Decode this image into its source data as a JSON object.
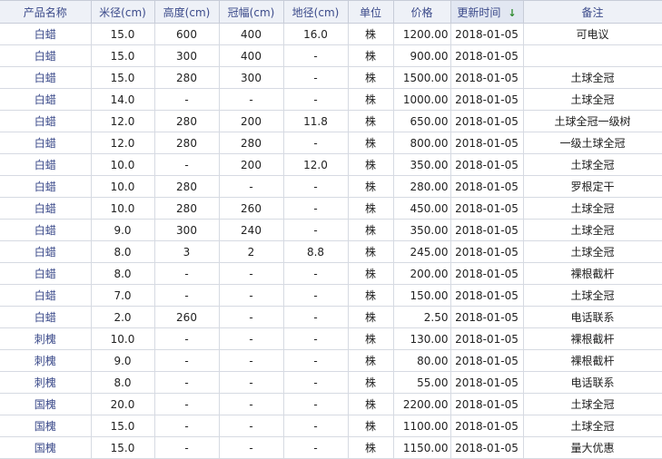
{
  "headers": {
    "name": "产品名称",
    "diameter": "米径(cm)",
    "height": "高度(cm)",
    "crown": "冠幅(cm)",
    "ground": "地径(cm)",
    "unit": "单位",
    "price": "价格",
    "updated": "更新时间",
    "note": "备注"
  },
  "sort_icon": "sort-down-arrow-icon",
  "sort_symbol": "↓",
  "rows": [
    {
      "name": "白蜡",
      "diameter": "15.0",
      "height": "600",
      "crown": "400",
      "ground": "16.0",
      "unit": "株",
      "price": "1200.00",
      "updated": "2018-01-05",
      "note": "可电议"
    },
    {
      "name": "白蜡",
      "diameter": "15.0",
      "height": "300",
      "crown": "400",
      "ground": "-",
      "unit": "株",
      "price": "900.00",
      "updated": "2018-01-05",
      "note": ""
    },
    {
      "name": "白蜡",
      "diameter": "15.0",
      "height": "280",
      "crown": "300",
      "ground": "-",
      "unit": "株",
      "price": "1500.00",
      "updated": "2018-01-05",
      "note": "土球全冠"
    },
    {
      "name": "白蜡",
      "diameter": "14.0",
      "height": "-",
      "crown": "-",
      "ground": "-",
      "unit": "株",
      "price": "1000.00",
      "updated": "2018-01-05",
      "note": "土球全冠"
    },
    {
      "name": "白蜡",
      "diameter": "12.0",
      "height": "280",
      "crown": "200",
      "ground": "11.8",
      "unit": "株",
      "price": "650.00",
      "updated": "2018-01-05",
      "note": "土球全冠一级树"
    },
    {
      "name": "白蜡",
      "diameter": "12.0",
      "height": "280",
      "crown": "280",
      "ground": "-",
      "unit": "株",
      "price": "800.00",
      "updated": "2018-01-05",
      "note": "一级土球全冠"
    },
    {
      "name": "白蜡",
      "diameter": "10.0",
      "height": "-",
      "crown": "200",
      "ground": "12.0",
      "unit": "株",
      "price": "350.00",
      "updated": "2018-01-05",
      "note": "土球全冠"
    },
    {
      "name": "白蜡",
      "diameter": "10.0",
      "height": "280",
      "crown": "-",
      "ground": "-",
      "unit": "株",
      "price": "280.00",
      "updated": "2018-01-05",
      "note": "罗根定干"
    },
    {
      "name": "白蜡",
      "diameter": "10.0",
      "height": "280",
      "crown": "260",
      "ground": "-",
      "unit": "株",
      "price": "450.00",
      "updated": "2018-01-05",
      "note": "土球全冠"
    },
    {
      "name": "白蜡",
      "diameter": "9.0",
      "height": "300",
      "crown": "240",
      "ground": "-",
      "unit": "株",
      "price": "350.00",
      "updated": "2018-01-05",
      "note": "土球全冠"
    },
    {
      "name": "白蜡",
      "diameter": "8.0",
      "height": "3",
      "crown": "2",
      "ground": "8.8",
      "unit": "株",
      "price": "245.00",
      "updated": "2018-01-05",
      "note": "土球全冠"
    },
    {
      "name": "白蜡",
      "diameter": "8.0",
      "height": "-",
      "crown": "-",
      "ground": "-",
      "unit": "株",
      "price": "200.00",
      "updated": "2018-01-05",
      "note": "裸根截杆"
    },
    {
      "name": "白蜡",
      "diameter": "7.0",
      "height": "-",
      "crown": "-",
      "ground": "-",
      "unit": "株",
      "price": "150.00",
      "updated": "2018-01-05",
      "note": "土球全冠"
    },
    {
      "name": "白蜡",
      "diameter": "2.0",
      "height": "260",
      "crown": "-",
      "ground": "-",
      "unit": "株",
      "price": "2.50",
      "updated": "2018-01-05",
      "note": "电话联系"
    },
    {
      "name": "刺槐",
      "diameter": "10.0",
      "height": "-",
      "crown": "-",
      "ground": "-",
      "unit": "株",
      "price": "130.00",
      "updated": "2018-01-05",
      "note": "裸根截杆"
    },
    {
      "name": "刺槐",
      "diameter": "9.0",
      "height": "-",
      "crown": "-",
      "ground": "-",
      "unit": "株",
      "price": "80.00",
      "updated": "2018-01-05",
      "note": "裸根截杆"
    },
    {
      "name": "刺槐",
      "diameter": "8.0",
      "height": "-",
      "crown": "-",
      "ground": "-",
      "unit": "株",
      "price": "55.00",
      "updated": "2018-01-05",
      "note": "电话联系"
    },
    {
      "name": "国槐",
      "diameter": "20.0",
      "height": "-",
      "crown": "-",
      "ground": "-",
      "unit": "株",
      "price": "2200.00",
      "updated": "2018-01-05",
      "note": "土球全冠"
    },
    {
      "name": "国槐",
      "diameter": "15.0",
      "height": "-",
      "crown": "-",
      "ground": "-",
      "unit": "株",
      "price": "1100.00",
      "updated": "2018-01-05",
      "note": "土球全冠"
    },
    {
      "name": "国槐",
      "diameter": "15.0",
      "height": "-",
      "crown": "-",
      "ground": "-",
      "unit": "株",
      "price": "1150.00",
      "updated": "2018-01-05",
      "note": "量大优惠"
    }
  ]
}
